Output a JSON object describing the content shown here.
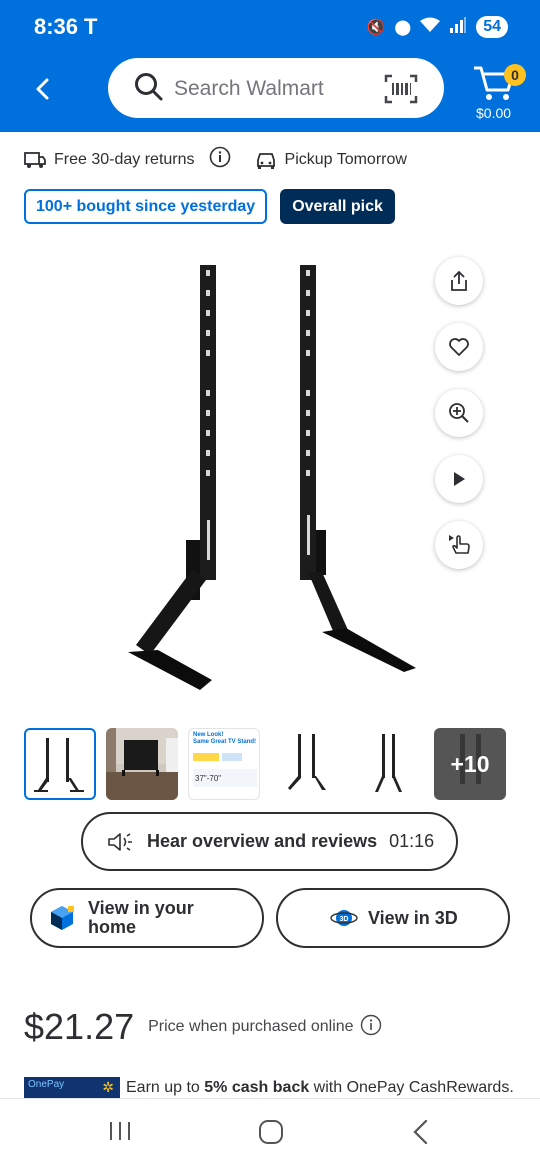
{
  "status": {
    "time": "8:36",
    "battery": "54"
  },
  "header": {
    "search_placeholder": "Search Walmart",
    "cart_count": "0",
    "cart_total": "$0.00"
  },
  "benefits": {
    "returns": "Free 30-day returns",
    "pickup": "Pickup Tomorrow"
  },
  "badges": {
    "bought": "100+ bought since yesterday",
    "pick": "Overall pick"
  },
  "thumbnails": {
    "promo_line1": "New Look!",
    "promo_line2": "Same Great TV Stand!",
    "promo_range": "37\"-70\"",
    "more": "+10"
  },
  "audio": {
    "label": "Hear overview and reviews",
    "duration": "01:16"
  },
  "buttons": {
    "view_home_line1": "View in your",
    "view_home_line2": "home",
    "view_3d": "View in 3D"
  },
  "price": {
    "amount": "$21.27",
    "note": "Price when purchased online"
  },
  "onepay": {
    "card_label": "OnePay",
    "text_pre": "Earn up to ",
    "text_bold": "5% cash back",
    "text_post": " with OnePay CashRewards."
  },
  "colors": {
    "brand_blue": "#0071dc",
    "dark_navy": "#002d58",
    "spark_yellow": "#ffc220"
  }
}
